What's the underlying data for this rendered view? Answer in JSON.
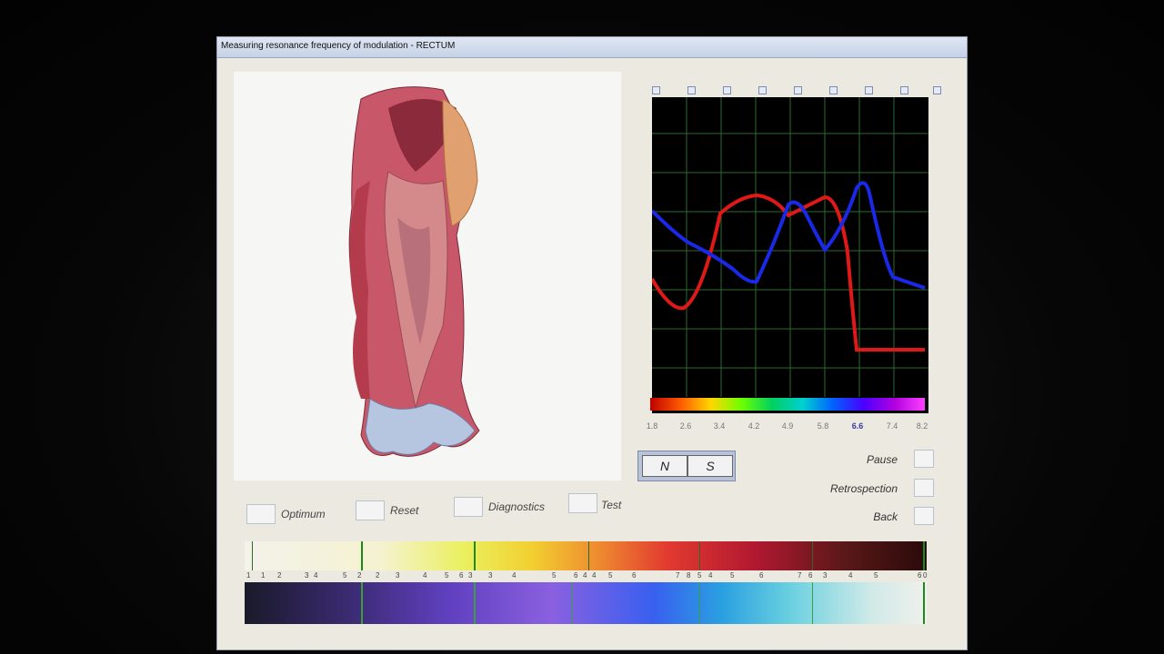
{
  "window": {
    "title": "Measuring resonance frequency of modulation - RECTUM"
  },
  "graph": {
    "tick_labels": [
      "1.8",
      "2.6",
      "3.4",
      "4.2",
      "4.9",
      "5.8",
      "6.6",
      "7.4",
      "8.2"
    ],
    "active_tick": "6.6",
    "colors": {
      "red": "#e01818",
      "blue": "#1a28e8",
      "grid": "#2c6a2c"
    }
  },
  "ns": {
    "n_label": "N",
    "s_label": "S"
  },
  "controls": {
    "pause": "Pause",
    "retrospection": "Retrospection",
    "back": "Back"
  },
  "bottom": {
    "optimum": "Optimum",
    "reset": "Reset",
    "diagnostics": "Diagnostics",
    "test": "Test"
  },
  "freq_top_numbers": [
    "1",
    "1",
    "2",
    "3",
    "4",
    "5",
    "2",
    "2",
    "3",
    "4",
    "5",
    "6",
    "3",
    "3",
    "4",
    "5",
    "6",
    "4",
    "4",
    "5",
    "6",
    "7",
    "8",
    "5",
    "4",
    "5",
    "6",
    "7",
    "6",
    "3",
    "4",
    "5",
    "6",
    "0"
  ],
  "freq_mid_numbers": [
    "3",
    "4",
    "1",
    "2",
    "4",
    "5",
    "6",
    "3",
    "3",
    "4",
    "5",
    "6",
    "6",
    "3"
  ]
}
